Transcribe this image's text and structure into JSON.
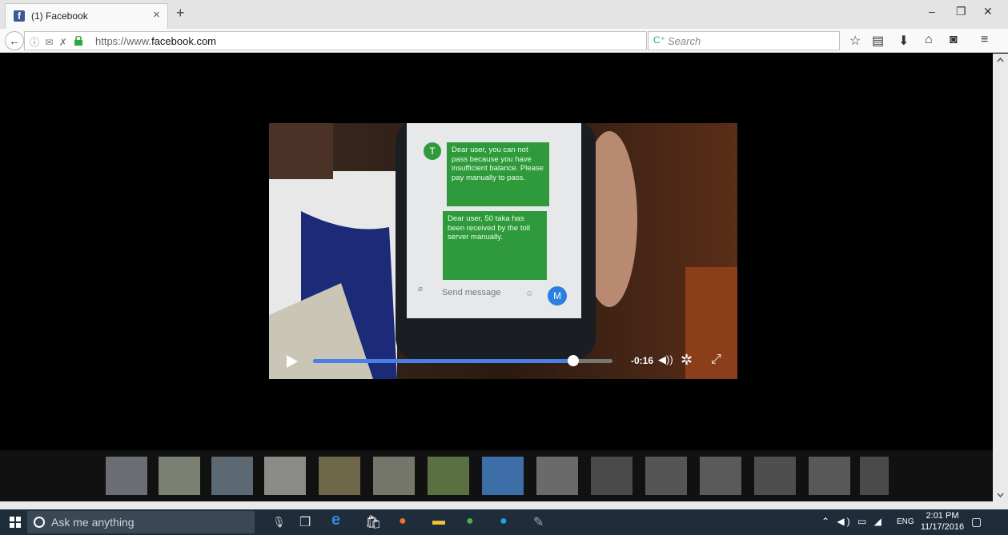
{
  "browser": {
    "tab_title": "(1) Facebook",
    "tab_close": "×",
    "new_tab": "+",
    "url_prefix": "https://www.",
    "url_domain": "facebook.com",
    "search_placeholder": "Search",
    "window_minimize": "–",
    "window_restore": "❐",
    "window_close": "✕"
  },
  "video": {
    "remaining_time": "-0:16",
    "progress_fraction": 0.87,
    "phone_messages": [
      "Dear user, you can not pass because you have insufficient balance. Please pay manually to pass.",
      "Dear user, 50 taka has been received by the toll server manually."
    ],
    "sender_avatar_letter": "T",
    "send_placeholder": "Send message",
    "send_button_letter": "M"
  },
  "taskbar": {
    "search_placeholder": "Ask me anything",
    "language": "ENG",
    "time": "2:01 PM",
    "date": "11/17/2016"
  },
  "colors": {
    "facebook_blue": "#3b5998",
    "progress_blue": "#4a7fe8",
    "sms_green": "#2f9a3b",
    "taskbar": "#1f2c39"
  }
}
